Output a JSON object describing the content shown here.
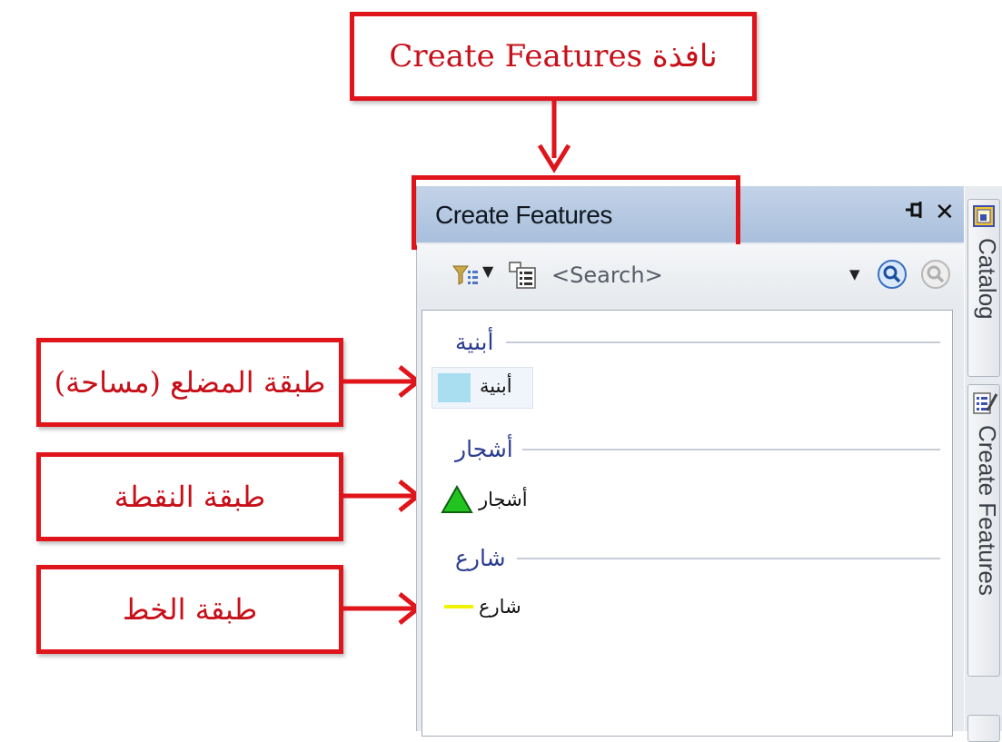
{
  "annotations": {
    "top_callout": "نافذة Create Features",
    "polygon_callout": "طبقة المضلع (مساحة)",
    "point_callout": "طبقة النقطة",
    "line_callout": "طبقة الخط"
  },
  "panel": {
    "title": "Create Features",
    "pin_glyph": "⊣",
    "close_glyph": "✕",
    "search_placeholder": "<Search>"
  },
  "groups": [
    {
      "header": "أبنية",
      "item_label": "أبنية",
      "geometry": "polygon",
      "swatch_color": "#a9def0"
    },
    {
      "header": "أشجار",
      "item_label": "أشجار",
      "geometry": "point",
      "swatch_color": "#22c51f"
    },
    {
      "header": "شارع",
      "item_label": "شارع",
      "geometry": "line",
      "swatch_color": "#f2f200"
    }
  ],
  "side_tabs": [
    {
      "label": "Catalog"
    },
    {
      "label": "Create Features"
    }
  ],
  "colors": {
    "callout_red": "#e0141b",
    "title_bar": "#b6c8e2",
    "group_header_text": "#2b3d8f"
  }
}
